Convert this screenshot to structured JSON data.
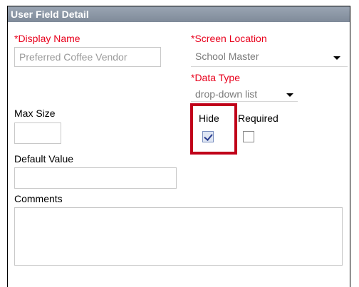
{
  "header": {
    "title": "User Field Detail"
  },
  "display_name": {
    "label": "*Display Name",
    "value": "Preferred Coffee Vendor"
  },
  "screen_location": {
    "label": "*Screen Location",
    "value": "School Master"
  },
  "data_type": {
    "label": "*Data Type",
    "value": "drop-down list"
  },
  "max_size": {
    "label": "Max Size",
    "value": ""
  },
  "hide": {
    "label": "Hide",
    "checked": true
  },
  "required": {
    "label": "Required",
    "checked": false
  },
  "default_value": {
    "label": "Default Value",
    "value": ""
  },
  "comments": {
    "label": "Comments",
    "value": ""
  },
  "colors": {
    "required_label": "#e8001c",
    "highlight": "#c0001a",
    "header_bg": "#8792a1"
  }
}
